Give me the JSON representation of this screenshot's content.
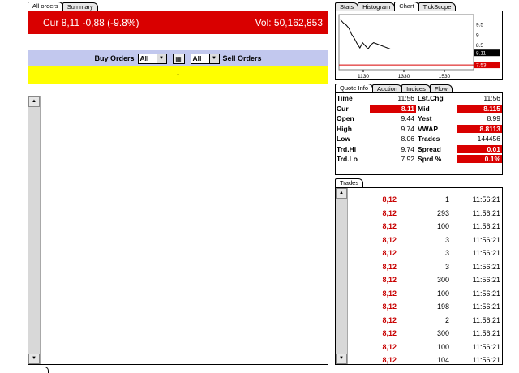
{
  "left_tabs": [
    "All orders",
    "Summary"
  ],
  "ticker": {
    "cur_text": "Cur 8,11 -0,88 (-9.8%)",
    "vol_text": "Vol: 50,162,853"
  },
  "orders_bar": {
    "buy_label": "Buy Orders",
    "buy_select": "All",
    "sell_select": "All",
    "sell_label": "Sell Orders"
  },
  "yellow_text": "-",
  "chart_tabs": [
    "Stats",
    "Histogram",
    "Chart",
    "TickScope"
  ],
  "chart_data": {
    "type": "line",
    "x_ticks": [
      "1130",
      "1330",
      "1530"
    ],
    "y_ticks": [
      "9.5",
      "9",
      "8.5"
    ],
    "series": [
      {
        "values": [
          9.7,
          9.55,
          9.45,
          9.3,
          9.0,
          8.8,
          8.55,
          8.35,
          8.6,
          8.45,
          8.3,
          8.5,
          8.6,
          8.55,
          8.5,
          8.45,
          8.4,
          8.35,
          8.3
        ]
      }
    ],
    "markers": [
      {
        "label": "8.11",
        "value": 8.11,
        "color": "#000000"
      },
      {
        "label": "7.53",
        "value": 7.53,
        "color": "#d90000"
      }
    ],
    "ylim": [
      7.3,
      9.95
    ]
  },
  "quote_tabs": [
    "Quote Info",
    "Auction",
    "Indices",
    "Flow"
  ],
  "quote_rows": [
    {
      "k1": "Time",
      "v1": "11:56",
      "k2": "Lst.Chg",
      "v2": "11:56",
      "h1": false,
      "h2": false
    },
    {
      "k1": "Cur",
      "v1": "8.11",
      "k2": "Mid",
      "v2": "8.115",
      "h1": true,
      "h2": true
    },
    {
      "k1": "Open",
      "v1": "9.44",
      "k2": "Yest",
      "v2": "8.99",
      "h1": false,
      "h2": false
    },
    {
      "k1": "High",
      "v1": "9.74",
      "k2": "VWAP",
      "v2": "8.8113",
      "h1": false,
      "h2": true
    },
    {
      "k1": "Low",
      "v1": "8.06",
      "k2": "Trades",
      "v2": "144456",
      "h1": false,
      "h2": false
    },
    {
      "k1": "Trd.Hi",
      "v1": "9.74",
      "k2": "Spread",
      "v2": "0.01",
      "h1": false,
      "h2": true
    },
    {
      "k1": "Trd.Lo",
      "v1": "7.92",
      "k2": "Sprd %",
      "v2": "0.1%",
      "h1": false,
      "h2": true
    }
  ],
  "trades_tab": "Trades",
  "trades": [
    {
      "price": "8,12",
      "qty": "1",
      "time": "11:56:21"
    },
    {
      "price": "8,12",
      "qty": "293",
      "time": "11:56:21"
    },
    {
      "price": "8,12",
      "qty": "100",
      "time": "11:56:21"
    },
    {
      "price": "8,12",
      "qty": "3",
      "time": "11:56:21"
    },
    {
      "price": "8,12",
      "qty": "3",
      "time": "11:56:21"
    },
    {
      "price": "8,12",
      "qty": "3",
      "time": "11:56:21"
    },
    {
      "price": "8,12",
      "qty": "300",
      "time": "11:56:21"
    },
    {
      "price": "8,12",
      "qty": "100",
      "time": "11:56:21"
    },
    {
      "price": "8,12",
      "qty": "198",
      "time": "11:56:21"
    },
    {
      "price": "8,12",
      "qty": "2",
      "time": "11:56:21"
    },
    {
      "price": "8,12",
      "qty": "300",
      "time": "11:56:21"
    },
    {
      "price": "8,12",
      "qty": "100",
      "time": "11:56:21"
    },
    {
      "price": "8,12",
      "qty": "104",
      "time": "11:56:21"
    }
  ],
  "colors": {
    "ticker_bg": "#d90000",
    "orders_bar_bg": "#c2c8ee",
    "yellow_bar_bg": "#ffff00",
    "highlight": "#d90000"
  },
  "icons": {
    "scroll_up": "scroll-up-arrow-icon",
    "scroll_down": "scroll-down-arrow-icon",
    "dropdown": "dropdown-arrow-icon",
    "mid": "order-book-icon"
  }
}
